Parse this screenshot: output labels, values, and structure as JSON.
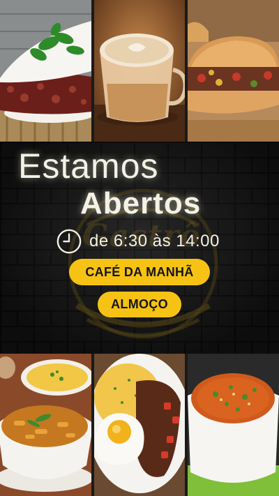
{
  "banner": {
    "title_line_1": "Estamos",
    "title_line_2": "Abertos",
    "hours": "de 6:30 às 14:00",
    "watermark_text": "Gastrô",
    "buttons": [
      {
        "label": "CAFÉ DA MANHÃ"
      },
      {
        "label": "ALMOÇO"
      }
    ]
  },
  "colors": {
    "accent_yellow": "#f6c315",
    "text_light": "#f4f1e6",
    "wall_dark": "#1c1c1c"
  },
  "icons": {
    "hours_icon": "clock-icon"
  },
  "photos": {
    "top": [
      "tapioca-photo",
      "cappuccino-photo",
      "sandwich-photo"
    ],
    "bottom": [
      "soup-and-rice-photo",
      "plate-with-egg-photo",
      "bowl-soup-photo"
    ]
  }
}
